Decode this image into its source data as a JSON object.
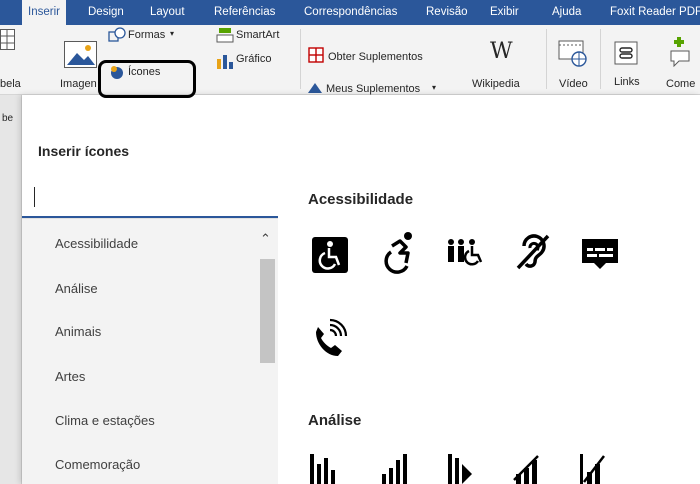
{
  "ribbon": {
    "tabs": [
      {
        "label": "Inserir",
        "active": true
      },
      {
        "label": "Design"
      },
      {
        "label": "Layout"
      },
      {
        "label": "Referências"
      },
      {
        "label": "Correspondências"
      },
      {
        "label": "Revisão"
      },
      {
        "label": "Exibir"
      },
      {
        "label": "Ajuda"
      },
      {
        "label": "Foxit Reader PDF"
      }
    ],
    "tabela_label": "bela",
    "imagens_label": "Imagen",
    "formas_label": "Formas",
    "icones_label": "Ícones",
    "smartart_label": "SmartArt",
    "grafico_label": "Gráfico",
    "obter_suplementos_label": "Obter Suplementos",
    "meus_suplementos_label": "Meus Suplementos",
    "wikipedia_label": "Wikipedia",
    "video_label": "Vídeo",
    "links_label": "Links",
    "comentario_label": "Come",
    "doc_strip_label": "be"
  },
  "dialog": {
    "title": "Inserir ícones",
    "search_value": "",
    "categories": [
      "Acessibilidade",
      "Análise",
      "Animais",
      "Artes",
      "Clima e estações",
      "Comemoração"
    ],
    "sections": [
      {
        "title": "Acessibilidade"
      },
      {
        "title": "Análise"
      }
    ]
  },
  "colors": {
    "ribbon_blue": "#2b579a",
    "ribbon_bg": "#f3f3f3",
    "panel_bg": "#f3f3f3"
  }
}
